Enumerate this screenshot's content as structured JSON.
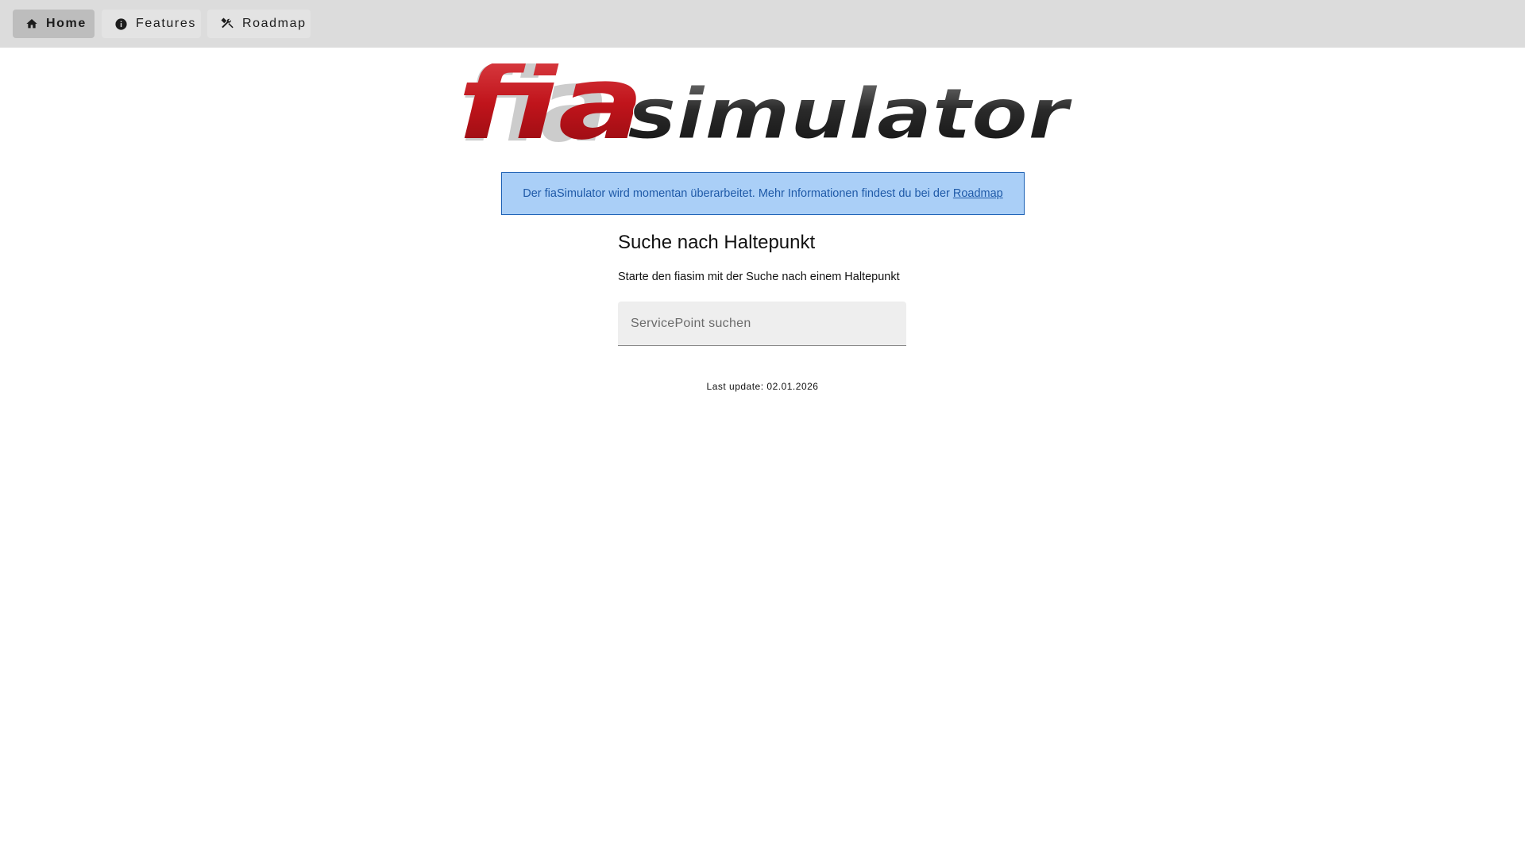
{
  "nav": {
    "items": [
      {
        "label": "Home",
        "icon": "home-icon",
        "active": true
      },
      {
        "label": "Features",
        "icon": "info-icon",
        "active": false
      },
      {
        "label": "Roadmap",
        "icon": "tools-icon",
        "active": false
      }
    ]
  },
  "logo": {
    "part1": "fia",
    "part2": "simulator",
    "colors": {
      "part1": "#c0141b",
      "part2": "#1a1a1a"
    }
  },
  "notice": {
    "text": "Der fiaSimulator wird momentan überarbeitet. Mehr Informationen findest du bei der",
    "link": "Roadmap",
    "background": "#aacff7",
    "border": "#1a5fb4"
  },
  "search": {
    "title": "Suche nach Haltepunkt",
    "subtitle": "Starte den fiasim mit der Suche nach einem Haltepunkt",
    "placeholder": "ServicePoint suchen",
    "value": ""
  },
  "footer": {
    "last_update": "Last update: 02.01.2026"
  }
}
